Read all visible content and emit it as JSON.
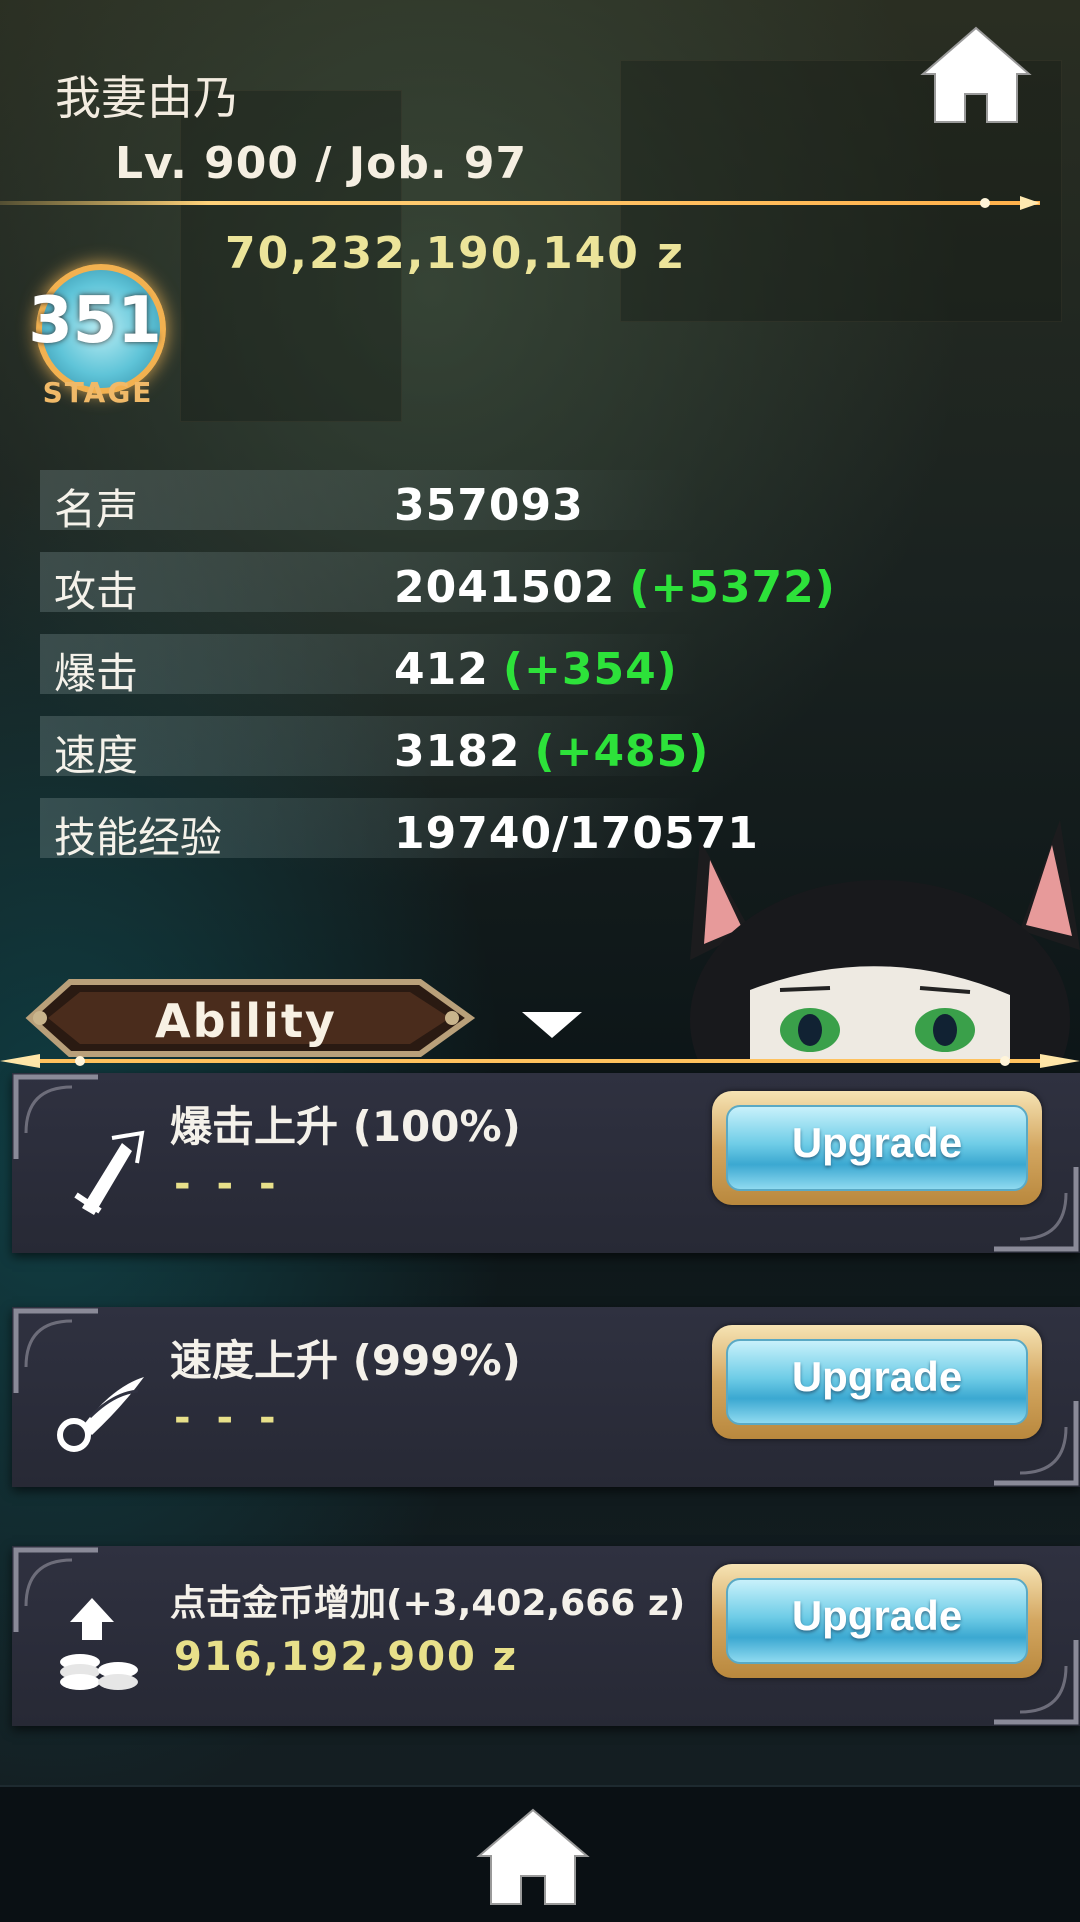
{
  "player": {
    "name": "我妻由乃",
    "level_line": "Lv. 900 / Job. 97",
    "money": "70,232,190,140 z"
  },
  "stage": {
    "number": "351",
    "label": "STAGE"
  },
  "stats": [
    {
      "label": "名声",
      "value": "357093",
      "bonus": ""
    },
    {
      "label": "攻击",
      "value": "2041502",
      "bonus": "(+5372)"
    },
    {
      "label": "爆击",
      "value": "412",
      "bonus": "(+354)"
    },
    {
      "label": "速度",
      "value": "3182",
      "bonus": "(+485)"
    },
    {
      "label": "技能经验",
      "value": "19740/170571",
      "bonus": ""
    }
  ],
  "ability": {
    "tab_label": "Ability",
    "cards": [
      {
        "title": "爆击上升 (100%)",
        "sub": "- - -",
        "button": "Upgrade",
        "icon": "sword-icon"
      },
      {
        "title": "速度上升 (999%)",
        "sub": "- - -",
        "button": "Upgrade",
        "icon": "winged-boot-icon"
      },
      {
        "title": "点击金币增加(+3,402,666 z)",
        "sub": "916,192,900 z",
        "button": "Upgrade",
        "icon": "coin-stack-icon"
      }
    ]
  },
  "colors": {
    "bonus_green": "#2de23a",
    "money_yellow": "#ece49a",
    "gold_accent": "#f2b150",
    "card_bg": "#2f3140"
  }
}
